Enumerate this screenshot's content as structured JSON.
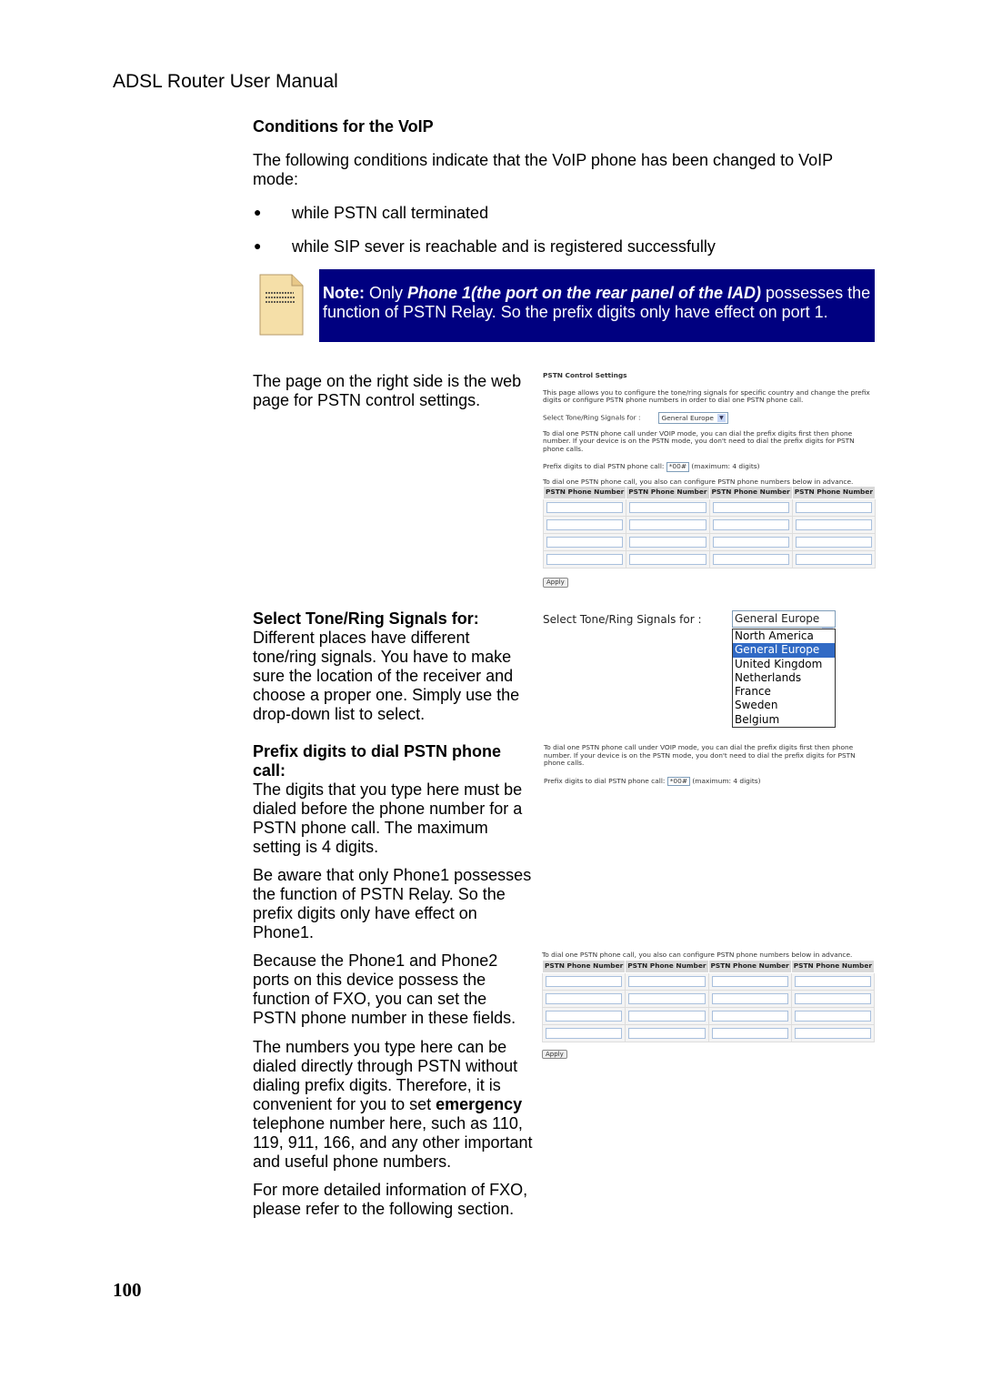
{
  "header": "ADSL Router User Manual",
  "section_title": "Conditions for the VoIP",
  "intro": "The following conditions indicate that the VoIP phone has been changed to VoIP mode:",
  "bullets": [
    "while PSTN call terminated",
    "while SIP sever is reachable and is registered successfully"
  ],
  "note": {
    "label": "Note:",
    "t1": " Only ",
    "em": "Phone 1(the port on the rear panel of the IAD)",
    "t2": " possesses the function of PSTN Relay. So the prefix digits only have effect on port 1.",
    "icon": "note-document-icon",
    "bg": "#000080"
  },
  "para_web": "The page on the right side is the web page for PSTN control settings.",
  "tone": {
    "heading": "Select Tone/Ring Signals for:",
    "body": "Different places have different tone/ring signals. You have to make sure the location of the receiver and choose a proper one. Simply use the drop-down list to select."
  },
  "prefix": {
    "heading": "Prefix digits to dial PSTN phone call:",
    "body": "The digits that you type here must be dialed before the phone number for a PSTN phone call. The maximum setting is 4 digits.",
    "aware": "Be aware that only Phone1 possesses the function of PSTN Relay. So the prefix digits only have effect on Phone1."
  },
  "fxo": "Because the Phone1 and Phone2 ports on this device possess the function of FXO, you can set the PSTN phone number in these fields.",
  "numbers": {
    "t1": "The numbers you type here can be dialed directly through PSTN without dialing prefix digits. Therefore, it is convenient for you to set ",
    "bold": "emergency",
    "t2": " telephone number here, such as 110, 119, 911, 166, and any other important and useful phone numbers."
  },
  "more": "For more detailed information of FXO, please refer to the following section.",
  "page_number": "100",
  "web": {
    "title": "PSTN Control Settings",
    "desc": "This page allows you to configure the tone/ring signals for specific country and change the prefix digits or configure PSTN phone numbers in order to dial one PSTN phone call.",
    "tone_label": "Select Tone/Ring Signals for :",
    "tone_value": "General Europe",
    "voip_text": "To dial one PSTN phone call under VOIP mode, you can dial the prefix digits first then phone number. If your device is on the PSTN mode, you don't need to dial the prefix digits for PSTN phone calls.",
    "prefix_label": "Prefix digits to dial PSTN phone call:",
    "prefix_value": "*00#",
    "prefix_max": "(maximum: 4 digits)",
    "numbers_text": "To dial one PSTN phone call, you also can configure PSTN phone numbers below in advance.",
    "col": "PSTN Phone Number",
    "apply": "Apply",
    "options": [
      "North America",
      "General Europe",
      "United Kingdom",
      "Netherlands",
      "France",
      "Sweden",
      "Belgium"
    ]
  }
}
